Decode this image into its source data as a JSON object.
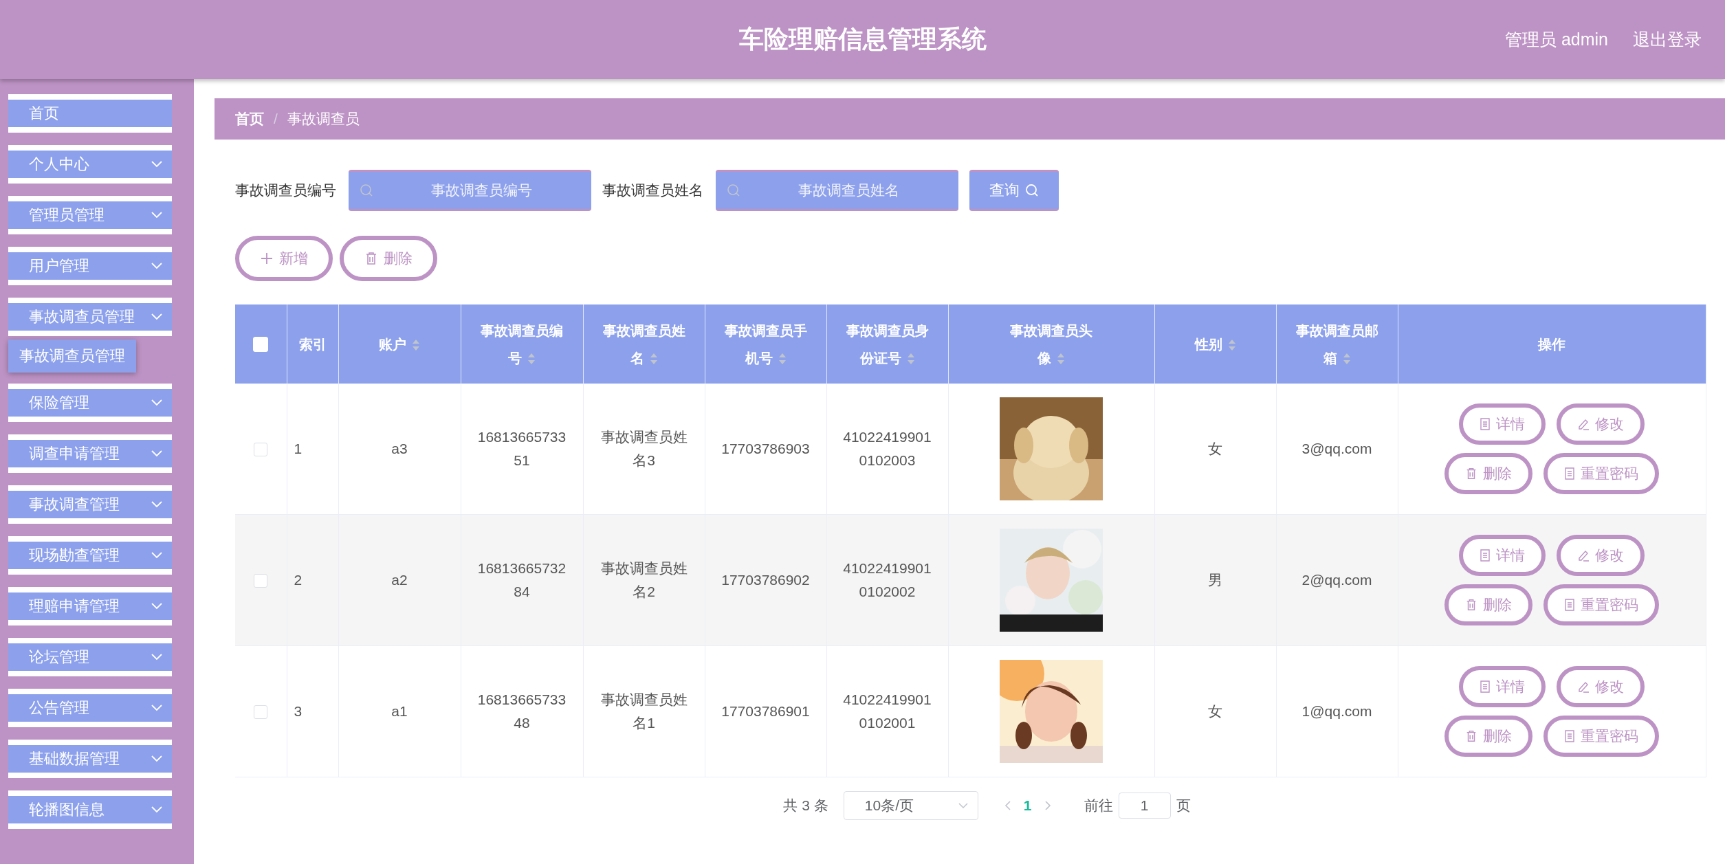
{
  "header": {
    "title": "车险理赔信息管理系统",
    "user": "管理员 admin",
    "logout": "退出登录"
  },
  "sidebar": {
    "items": [
      {
        "label": "首页",
        "kind": "link"
      },
      {
        "label": "个人中心",
        "kind": "menu"
      },
      {
        "label": "管理员管理",
        "kind": "menu"
      },
      {
        "label": "用户管理",
        "kind": "menu"
      },
      {
        "label": "事故调查员管理",
        "kind": "menu",
        "children": [
          {
            "label": "事故调查员管理",
            "selected": true
          }
        ]
      },
      {
        "label": "保险管理",
        "kind": "menu"
      },
      {
        "label": "调查申请管理",
        "kind": "menu"
      },
      {
        "label": "事故调查管理",
        "kind": "menu"
      },
      {
        "label": "现场勘查管理",
        "kind": "menu"
      },
      {
        "label": "理赔申请管理",
        "kind": "menu"
      },
      {
        "label": "论坛管理",
        "kind": "menu"
      },
      {
        "label": "公告管理",
        "kind": "menu"
      },
      {
        "label": "基础数据管理",
        "kind": "menu"
      },
      {
        "label": "轮播图信息",
        "kind": "menu"
      }
    ]
  },
  "breadcrumb": {
    "items": [
      "首页",
      "事故调查员"
    ],
    "separator": "/"
  },
  "search": {
    "fields": [
      {
        "label": "事故调查员编号",
        "placeholder": "事故调查员编号"
      },
      {
        "label": "事故调查员姓名",
        "placeholder": "事故调查员姓名"
      }
    ],
    "button": "查询"
  },
  "actions": [
    {
      "kind": "add",
      "label": "新增"
    },
    {
      "kind": "delete",
      "label": "删除"
    }
  ],
  "table": {
    "header_checked": false,
    "columns": [
      {
        "kind": "checkbox"
      },
      {
        "kind": "text",
        "label": "索引",
        "sortable": false
      },
      {
        "kind": "text",
        "label": "账户",
        "sortable": true
      },
      {
        "kind": "text",
        "label": "事故调查员编号",
        "sortable": true
      },
      {
        "kind": "text",
        "label": "事故调查员姓名",
        "sortable": true
      },
      {
        "kind": "text",
        "label": "事故调查员手机号",
        "sortable": true
      },
      {
        "kind": "text",
        "label": "事故调查员身份证号",
        "sortable": true
      },
      {
        "kind": "text",
        "label": "事故调查员头像",
        "sortable": true
      },
      {
        "kind": "text",
        "label": "性别",
        "sortable": true
      },
      {
        "kind": "text",
        "label": "事故调查员邮箱",
        "sortable": true
      },
      {
        "kind": "text",
        "label": "操作",
        "sortable": false
      }
    ],
    "rows": [
      {
        "checked": false,
        "index": "1",
        "account": "a3",
        "number": "1681366573351",
        "name": "事故调查员姓名3",
        "phone": "17703786903",
        "id_card": "410224199010102003",
        "gender": "女",
        "email": "3@qq.com",
        "actions": [
          {
            "kind": "detail",
            "label": "详情"
          },
          {
            "kind": "edit",
            "label": "修改"
          },
          {
            "kind": "delete",
            "label": "删除"
          },
          {
            "kind": "reset",
            "label": "重置密码"
          }
        ]
      },
      {
        "checked": false,
        "index": "2",
        "account": "a2",
        "number": "1681366573284",
        "name": "事故调查员姓名2",
        "phone": "17703786902",
        "id_card": "410224199010102002",
        "gender": "男",
        "email": "2@qq.com",
        "actions": [
          {
            "kind": "detail",
            "label": "详情"
          },
          {
            "kind": "edit",
            "label": "修改"
          },
          {
            "kind": "delete",
            "label": "删除"
          },
          {
            "kind": "reset",
            "label": "重置密码"
          }
        ]
      },
      {
        "checked": false,
        "index": "3",
        "account": "a1",
        "number": "1681366573348",
        "name": "事故调查员姓名1",
        "phone": "17703786901",
        "id_card": "410224199010102001",
        "gender": "女",
        "email": "1@qq.com",
        "actions": [
          {
            "kind": "detail",
            "label": "详情"
          },
          {
            "kind": "edit",
            "label": "修改"
          },
          {
            "kind": "delete",
            "label": "删除"
          },
          {
            "kind": "reset",
            "label": "重置密码"
          }
        ]
      }
    ]
  },
  "pagination": {
    "total": "共 3 条",
    "page_size": "10条/页",
    "pages": [
      {
        "label": "1",
        "selected": true
      }
    ],
    "goto_label": "前往",
    "goto_value": "1",
    "goto_suffix": "页"
  }
}
